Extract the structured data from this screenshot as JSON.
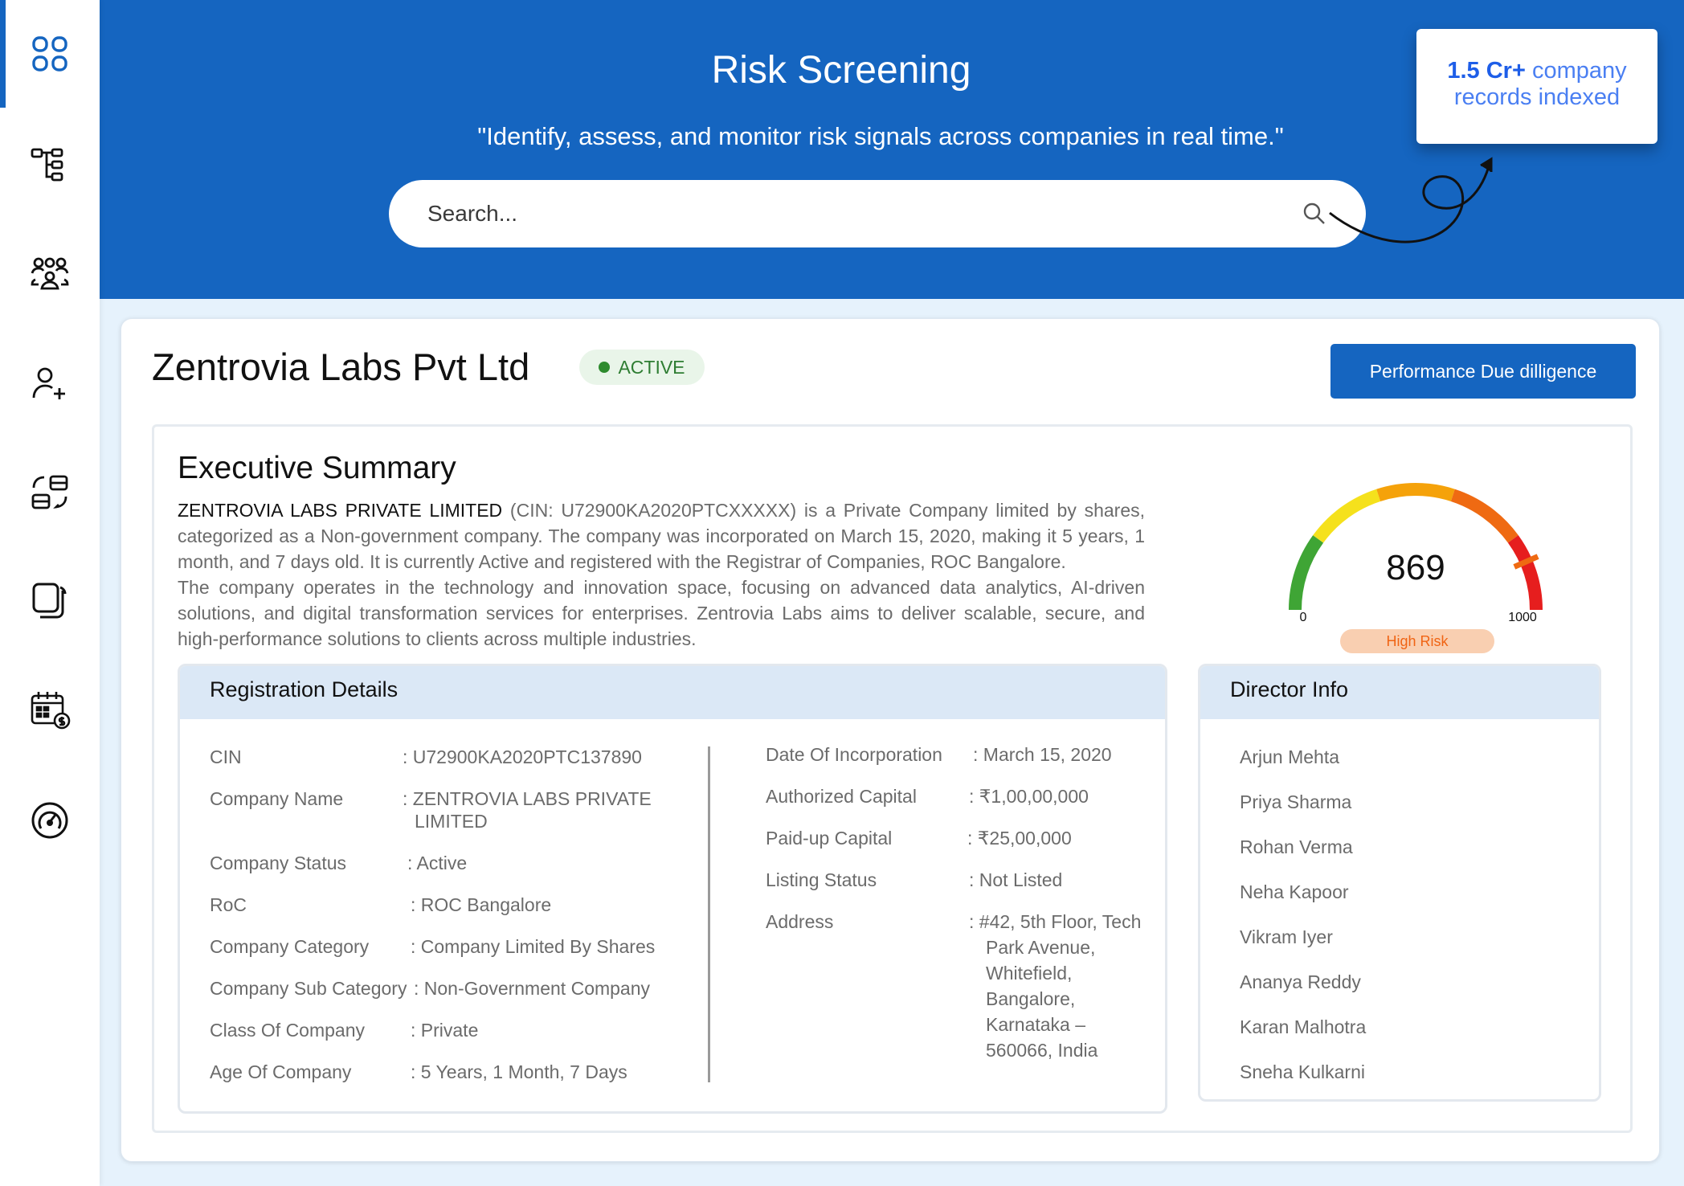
{
  "sidebar": {
    "items": [
      {
        "name": "dashboard-icon"
      },
      {
        "name": "hierarchy-icon"
      },
      {
        "name": "users-group-icon"
      },
      {
        "name": "add-user-icon"
      },
      {
        "name": "workflow-icon"
      },
      {
        "name": "documents-icon"
      },
      {
        "name": "calendar-billing-icon"
      },
      {
        "name": "speedometer-icon"
      }
    ]
  },
  "header": {
    "title": "Risk Screening",
    "tagline": "\"Identify, assess, and monitor risk signals across companies in real time.\"",
    "search_placeholder": "Search...",
    "callout_strong": "1.5 Cr+",
    "callout_rest_1": " company",
    "callout_rest_2": "records indexed"
  },
  "company": {
    "name": "Zentrovia Labs Pvt Ltd",
    "status": "ACTIVE",
    "action_button": "Performance Due dilligence"
  },
  "executive_summary": {
    "title": "Executive Summary",
    "lead": "ZENTROVIA LABS PRIVATE LIMITED",
    "text_1": " (CIN: U72900KA2020PTCXXXXX) is a Private Company limited by shares, categorized as a Non-government company. The company was incorporated on March 15, 2020, making it 5 years, 1 month, and 7 days old. It is currently Active and registered with the Registrar of Companies, ROC Bangalore.",
    "text_2": "The company operates in the technology and innovation space, focusing on advanced data analytics, AI-driven solutions, and digital transformation services for enterprises. Zentrovia Labs aims to deliver scalable, secure, and high-performance solutions to clients across multiple industries."
  },
  "risk_gauge": {
    "score": "869",
    "min": "0",
    "max": "1000",
    "score_value": 869,
    "label": "High Risk",
    "colors": [
      "#3fa535",
      "#f5e11c",
      "#f5a20a",
      "#ef6a12",
      "#e61e1e"
    ]
  },
  "registration": {
    "title": "Registration Details",
    "left": [
      {
        "label": "CIN",
        "value": ": U72900KA2020PTC137890"
      },
      {
        "label": "Company Name",
        "value": ": ZENTROVIA LABS PRIVATE",
        "value2": "LIMITED"
      },
      {
        "label": "Company Status",
        "value": ": Active"
      },
      {
        "label": "RoC",
        "value": ": ROC Bangalore"
      },
      {
        "label": "Company Category",
        "value": ": Company Limited By Shares"
      },
      {
        "label": "Company Sub Category",
        "value": ": Non-Government  Company"
      },
      {
        "label": "Class Of Company",
        "value": ": Private"
      },
      {
        "label": "Age Of Company",
        "value": ": 5 Years, 1 Month, 7 Days"
      }
    ],
    "right": [
      {
        "label": "Date Of Incorporation",
        "value": ": March 15, 2020"
      },
      {
        "label": "Authorized Capital",
        "value": ": ₹1,00,00,000"
      },
      {
        "label": "Paid-up Capital",
        "value": ": ₹25,00,000"
      },
      {
        "label": "Listing Status",
        "value": ": Not Listed"
      },
      {
        "label": "Address",
        "value": ": #42, 5th Floor, Tech",
        "lines": [
          "Park Avenue,",
          "Whitefield,",
          "Bangalore,",
          "Karnataka –",
          "560066, India"
        ]
      }
    ]
  },
  "directors": {
    "title": "Director Info",
    "names": [
      "Arjun Mehta",
      "Priya Sharma",
      "Rohan Verma",
      "Neha Kapoor",
      "Vikram Iyer",
      "Ananya Reddy",
      "Karan Malhotra",
      "Sneha Kulkarni"
    ]
  }
}
